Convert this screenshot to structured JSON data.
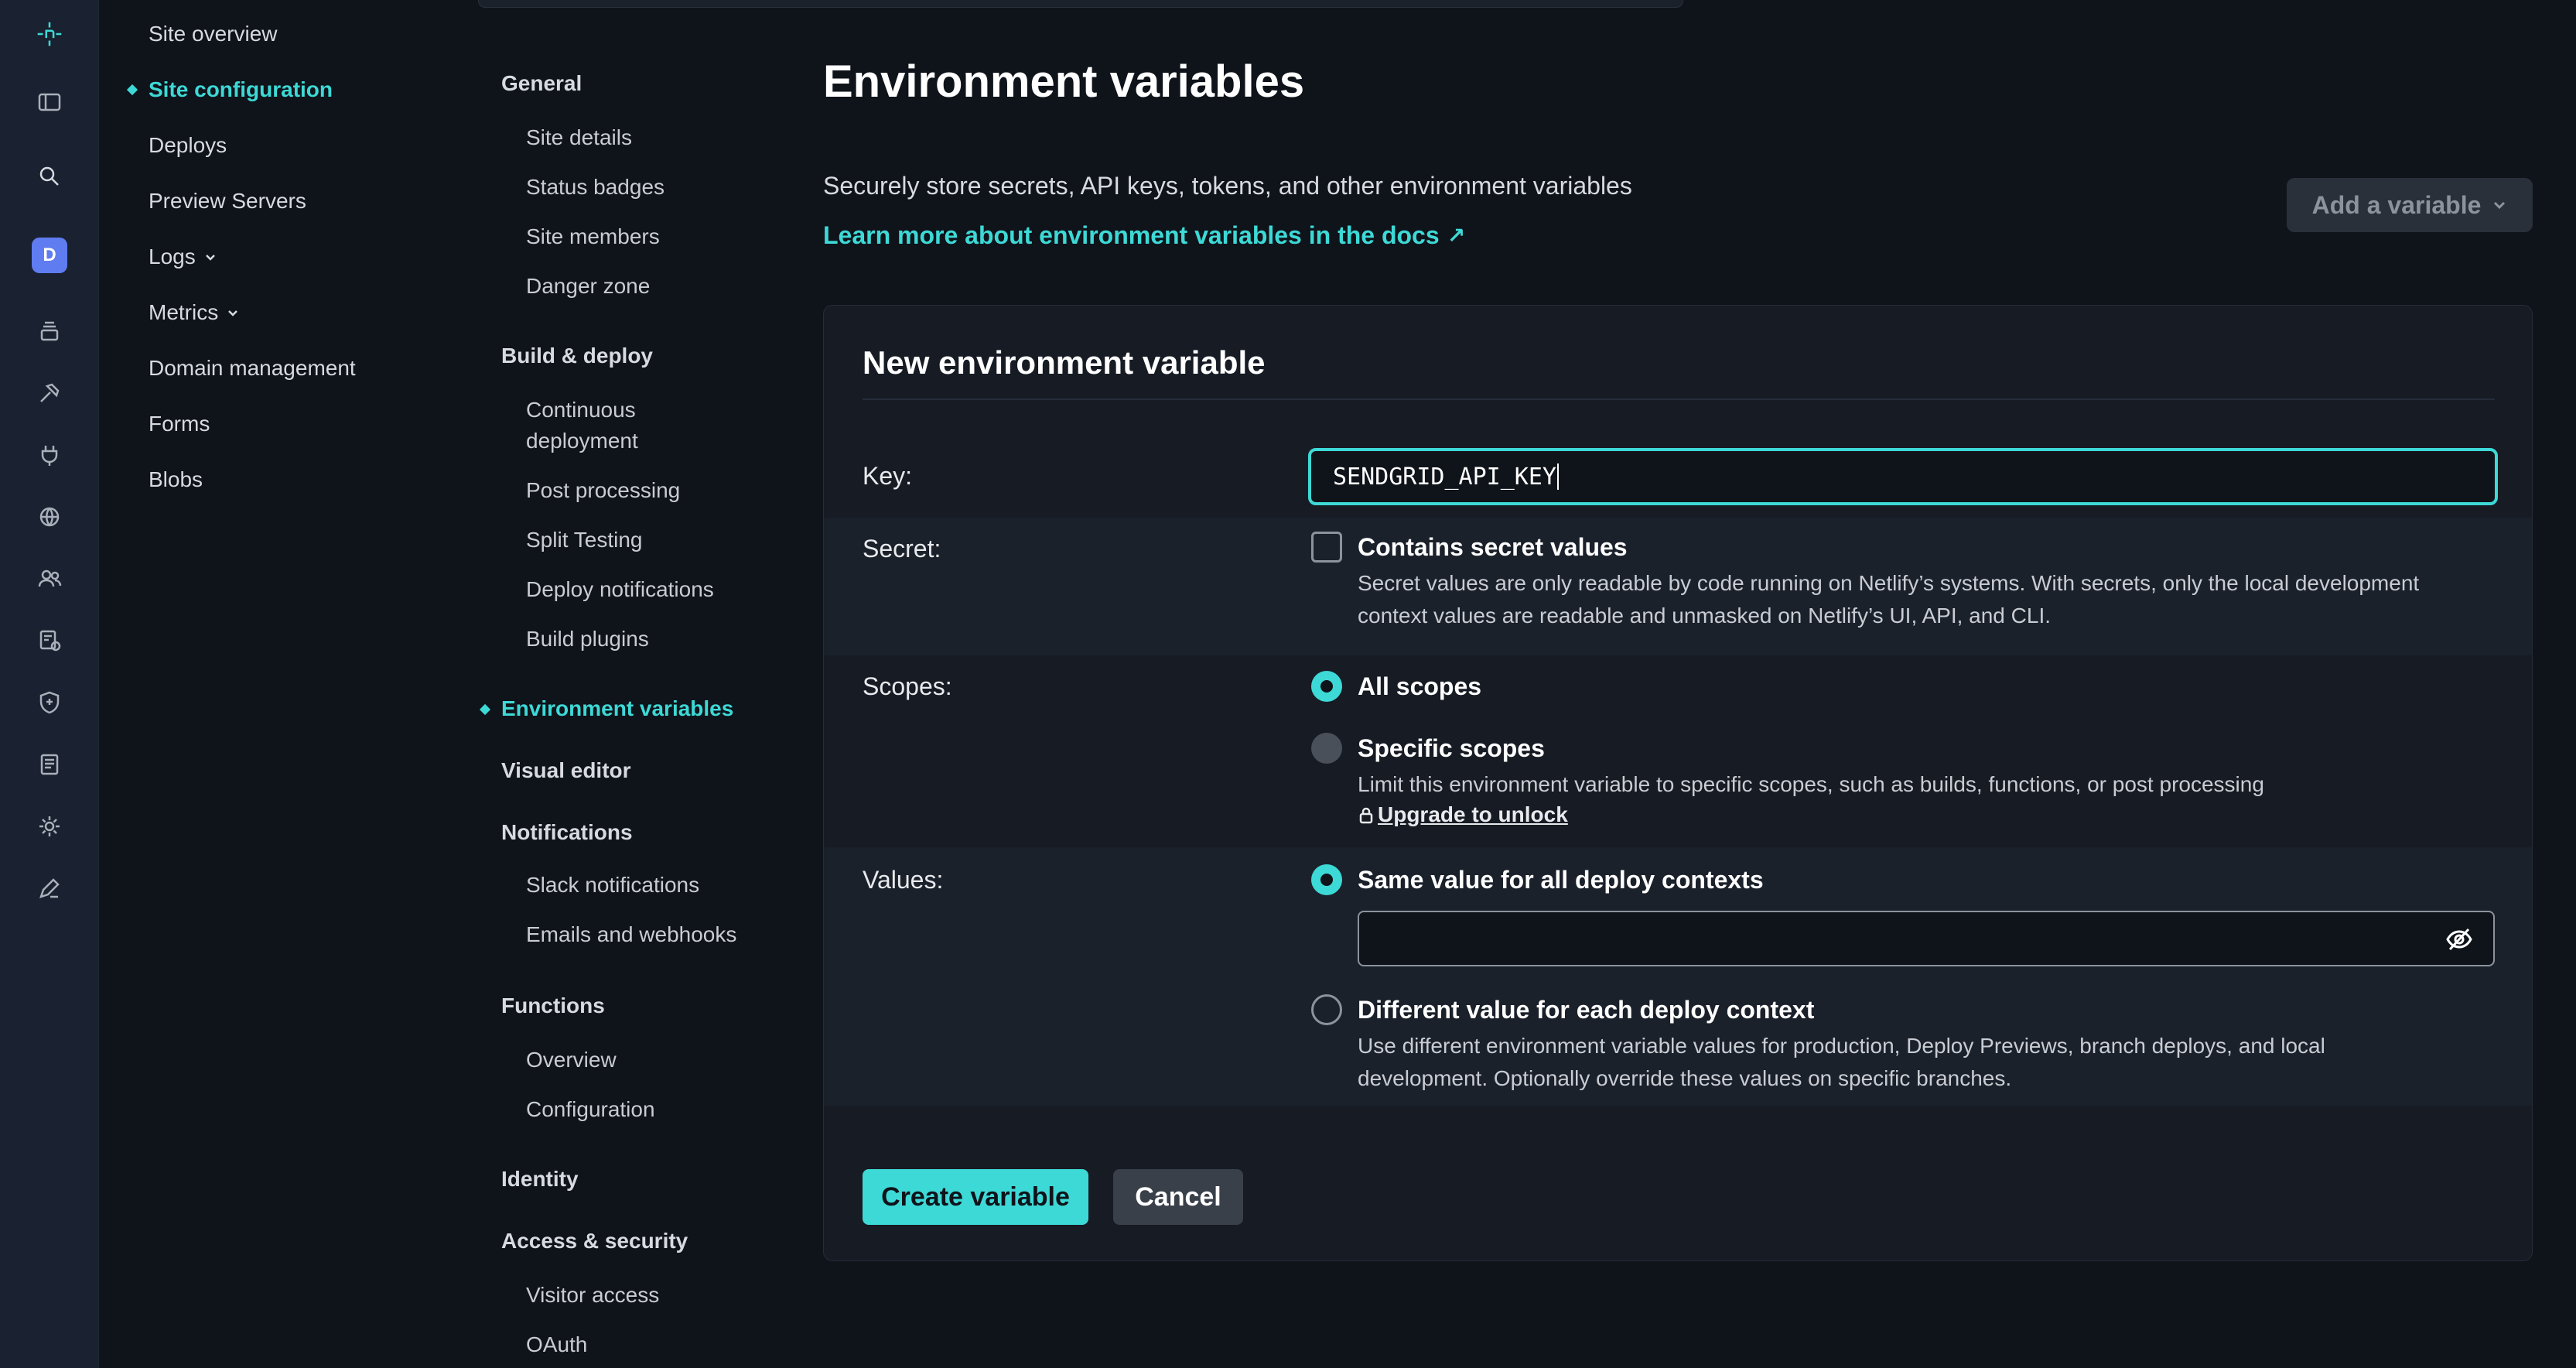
{
  "rail": {
    "avatar_letter": "D",
    "icons": [
      "netlify-logo-icon",
      "sidebar-toggle-icon",
      "search-icon",
      "team-avatar",
      "stack-icon",
      "hammer-icon",
      "plug-icon",
      "globe-icon",
      "users-icon",
      "certificate-icon",
      "shield-icon",
      "book-icon",
      "gear-icon",
      "pencil-icon"
    ]
  },
  "site_nav": {
    "items": [
      {
        "label": "Site overview"
      },
      {
        "label": "Site configuration",
        "active": true
      },
      {
        "label": "Deploys"
      },
      {
        "label": "Preview Servers"
      },
      {
        "label": "Logs"
      },
      {
        "label": "Metrics"
      },
      {
        "label": "Domain management"
      },
      {
        "label": "Forms"
      },
      {
        "label": "Blobs"
      }
    ]
  },
  "config_nav": {
    "general": {
      "heading": "General",
      "items": [
        "Site details",
        "Status badges",
        "Site members",
        "Danger zone"
      ]
    },
    "build": {
      "heading": "Build & deploy",
      "items": [
        "Continuous",
        "deployment",
        "Post processing",
        "Split Testing",
        "Deploy notifications",
        "Build plugins"
      ]
    },
    "env": {
      "heading": "Environment variables"
    },
    "visual": {
      "heading": "Visual editor"
    },
    "notifications": {
      "heading": "Notifications",
      "items": [
        "Slack notifications",
        "Emails and webhooks"
      ]
    },
    "functions": {
      "heading": "Functions",
      "items": [
        "Overview",
        "Configuration"
      ]
    },
    "identity": {
      "heading": "Identity"
    },
    "access": {
      "heading": "Access & security",
      "items": [
        "Visitor access",
        "OAuth"
      ]
    }
  },
  "main": {
    "title": "Environment variables",
    "description": "Securely store secrets, API keys, tokens, and other environment variables",
    "learn_link": "Learn more about environment variables in the docs",
    "learn_arrow": "↗",
    "add_button": "Add a variable"
  },
  "form": {
    "title": "New environment variable",
    "key_label": "Key:",
    "key_value": "SENDGRID_API_KEY",
    "secret_label": "Secret:",
    "secret_option": "Contains secret values",
    "secret_help_1": "Secret values are only readable by code running on Netlify’s systems. With secrets, only the local development",
    "secret_help_2": "context values are readable and unmasked on Netlify’s UI, API, and CLI.",
    "scopes_label": "Scopes:",
    "scope_all": "All scopes",
    "scope_specific": "Specific scopes",
    "scope_help": "Limit this environment variable to specific scopes, such as builds, functions, or post processing",
    "upgrade": "Upgrade to unlock",
    "values_label": "Values:",
    "value_same": "Same value for all deploy contexts",
    "value_input": "",
    "value_diff": "Different value for each deploy context",
    "value_diff_help_1": "Use different environment variable values for production, Deploy Previews, branch deploys, and local",
    "value_diff_help_2": "development. Optionally override these values on specific branches.",
    "create_button": "Create variable",
    "cancel_button": "Cancel"
  },
  "colors": {
    "accent": "#3dd9d6",
    "background": "#0f131a",
    "card": "#161b24",
    "rail": "#1a2130"
  }
}
